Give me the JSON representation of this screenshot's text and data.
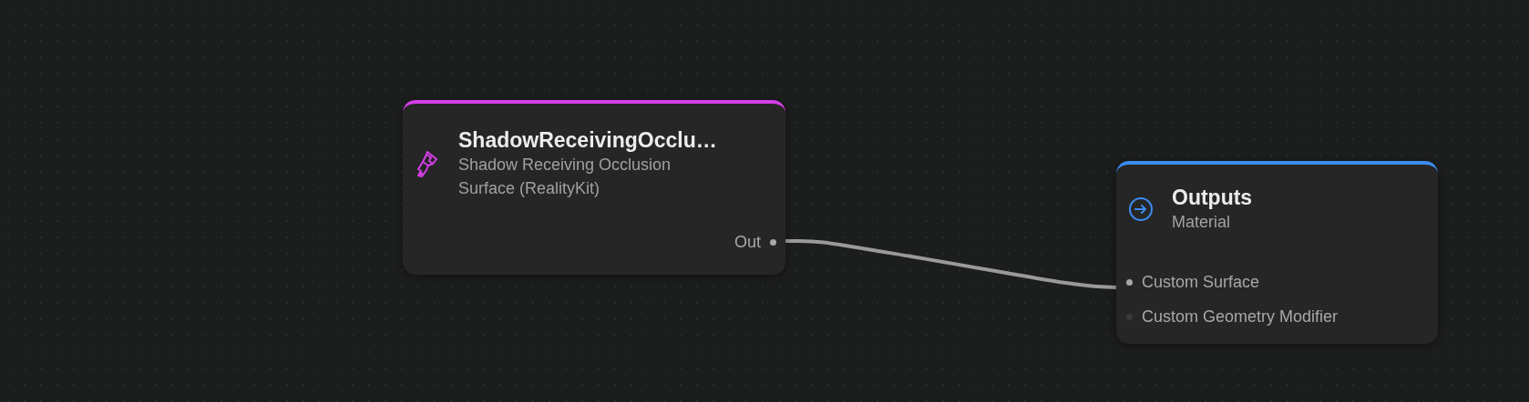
{
  "nodes": [
    {
      "kind": "surface",
      "color": "#d63ee8",
      "title": "ShadowReceivingOcclu…",
      "subtitle": "Shadow Receiving Occlusion Surface (RealityKit)",
      "outputs": [
        {
          "label": "Out",
          "connected": true
        }
      ]
    },
    {
      "kind": "output",
      "color": "#3b8cf0",
      "title": "Outputs",
      "subtitle": "Material",
      "inputs": [
        {
          "label": "Custom Surface",
          "connected": true
        },
        {
          "label": "Custom Geometry Modifier",
          "connected": false
        }
      ]
    }
  ]
}
